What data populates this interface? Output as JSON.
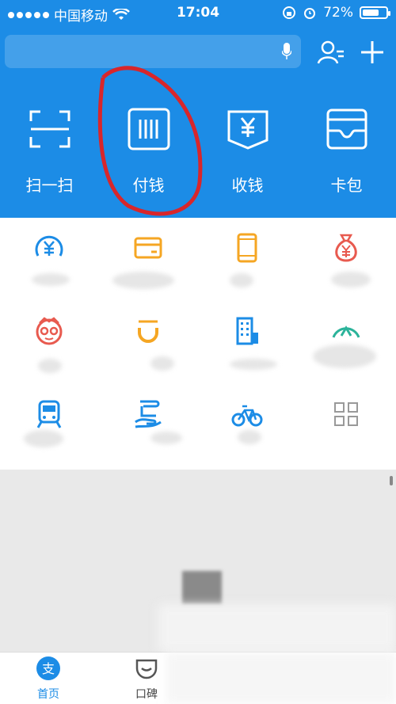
{
  "status": {
    "carrier": "中国移动",
    "time": "17:04",
    "battery": "72%",
    "battery_level": 0.72
  },
  "header": {
    "search_placeholder": ""
  },
  "quick_actions": [
    {
      "label": "扫一扫",
      "icon": "scan-icon"
    },
    {
      "label": "付钱",
      "icon": "barcode-icon"
    },
    {
      "label": "收钱",
      "icon": "yuan-receive-icon"
    },
    {
      "label": "卡包",
      "icon": "wallet-icon"
    }
  ],
  "grid": {
    "rows": [
      [
        "yuan-gauge-icon",
        "card-icon",
        "phone-icon",
        "money-bag-icon"
      ],
      [
        "glasses-face-icon",
        "didi-icon",
        "building-icon",
        "arc-meter-icon"
      ],
      [
        "train-icon",
        "hand-card-icon",
        "bicycle-icon",
        "more-grid-icon"
      ]
    ]
  },
  "tabbar": {
    "items": [
      {
        "label": "首页",
        "icon": "alipay-icon"
      },
      {
        "label": "口碑",
        "icon": "koubei-icon"
      }
    ]
  },
  "colors": {
    "brand": "#1c8ce6",
    "annotation": "#d8262b"
  }
}
